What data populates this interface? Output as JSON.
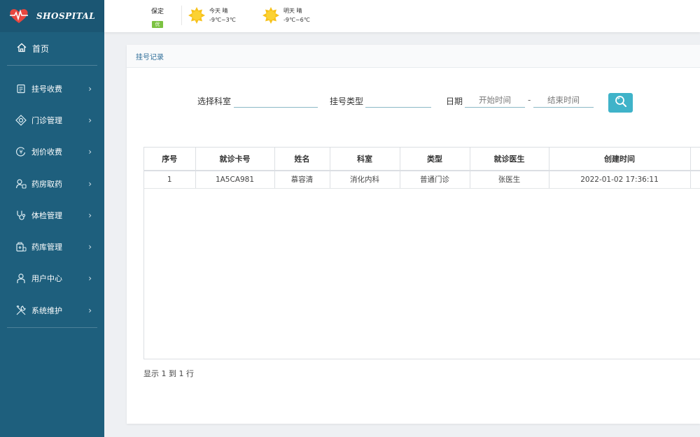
{
  "brand": {
    "name": "SHOSPITAL"
  },
  "sidebar": {
    "home_label": "首页",
    "items": [
      {
        "label": "挂号收费",
        "icon": "register-icon"
      },
      {
        "label": "门诊管理",
        "icon": "clinic-icon"
      },
      {
        "label": "划价收费",
        "icon": "billing-icon"
      },
      {
        "label": "药房取药",
        "icon": "pharmacy-icon"
      },
      {
        "label": "体检管理",
        "icon": "checkup-icon"
      },
      {
        "label": "药库管理",
        "icon": "warehouse-icon"
      },
      {
        "label": "用户中心",
        "icon": "user-icon"
      },
      {
        "label": "系统维护",
        "icon": "tools-icon"
      }
    ]
  },
  "weather": {
    "city": "保定",
    "aqi": "优",
    "today": {
      "label": "今天",
      "condition": "晴",
      "range": "-9℃~3℃"
    },
    "tomorrow": {
      "label": "明天",
      "condition": "晴",
      "range": "-9℃~6℃"
    }
  },
  "panel": {
    "title": "挂号记录"
  },
  "filters": {
    "department_label": "选择科室",
    "type_label": "挂号类型",
    "date_label": "日期",
    "start_placeholder": "开始时间",
    "separator": "-",
    "end_placeholder": "结束时间"
  },
  "table": {
    "columns": [
      "序号",
      "就诊卡号",
      "姓名",
      "科室",
      "类型",
      "就诊医生",
      "创建时间"
    ],
    "rows": [
      [
        "1",
        "1A5CA981",
        "慕容清",
        "消化内科",
        "普通门诊",
        "张医生",
        "2022-01-02 17:36:11"
      ]
    ]
  },
  "pagination": {
    "summary": "显示 1 到 1 行"
  },
  "colors": {
    "sidebar": "#1e5f7d",
    "accent": "#3fb3c9",
    "aqi": "#7cc242",
    "sun": "#f7c21b"
  }
}
